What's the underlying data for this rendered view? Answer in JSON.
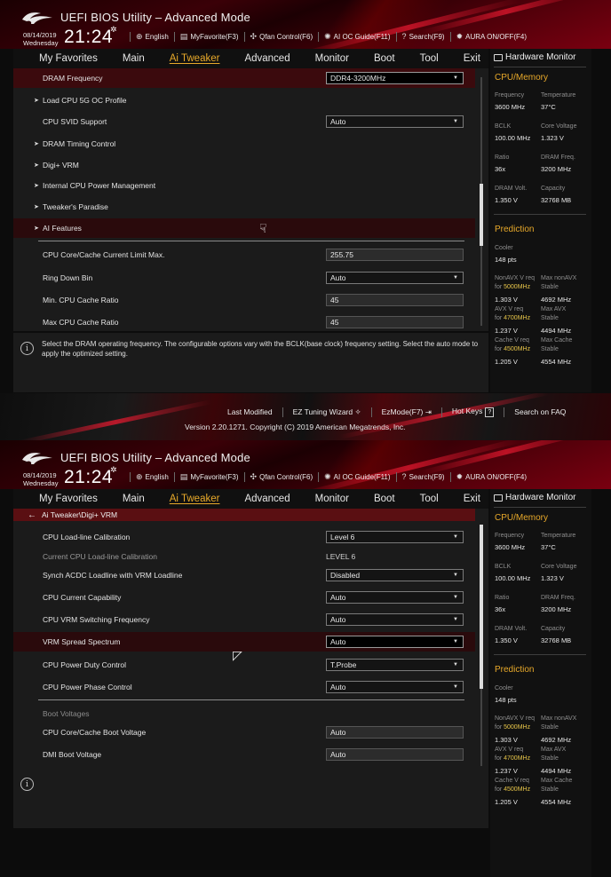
{
  "header": {
    "title": "UEFI BIOS Utility – Advanced Mode",
    "date": "08/14/2019",
    "weekday": "Wednesday",
    "time": "21:24",
    "toolbar": [
      {
        "icon": "globe-icon",
        "glyph": "⊕",
        "label": "English"
      },
      {
        "icon": "favorite-icon",
        "glyph": "▤",
        "label": "MyFavorite(F3)"
      },
      {
        "icon": "fan-icon",
        "glyph": "✣",
        "label": "Qfan Control(F6)"
      },
      {
        "icon": "ai-oc-icon",
        "glyph": "✺",
        "label": "AI OC Guide(F11)"
      },
      {
        "icon": "search-icon",
        "glyph": "?",
        "label": "Search(F9)"
      },
      {
        "icon": "aura-icon",
        "glyph": "✹",
        "label": "AURA ON/OFF(F4)"
      }
    ]
  },
  "nav": {
    "tabs": [
      "My Favorites",
      "Main",
      "Ai Tweaker",
      "Advanced",
      "Monitor",
      "Boot",
      "Tool",
      "Exit"
    ],
    "active": "Ai Tweaker"
  },
  "screen1": {
    "rows": [
      {
        "label": "DRAM Frequency",
        "value": "DDR4-3200MHz"
      },
      {
        "label": "Load CPU 5G OC Profile"
      },
      {
        "label": "CPU SVID Support",
        "value": "Auto"
      },
      {
        "label": "DRAM Timing Control"
      },
      {
        "label": "Digi+ VRM"
      },
      {
        "label": "Internal CPU Power Management"
      },
      {
        "label": "Tweaker's Paradise"
      },
      {
        "label": "AI Features"
      },
      {
        "label": "CPU Core/Cache Current Limit Max.",
        "value": "255.75"
      },
      {
        "label": "Ring Down Bin",
        "value": "Auto"
      },
      {
        "label": "Min. CPU Cache Ratio",
        "value": "45"
      },
      {
        "label": "Max CPU Cache Ratio",
        "value": "45"
      }
    ],
    "help": "Select the DRAM operating frequency. The configurable options vary with the BCLK(base clock) frequency setting. Select the auto mode to apply the optimized setting."
  },
  "screen2": {
    "breadcrumb": "Ai Tweaker\\Digi+ VRM",
    "rows": [
      {
        "label": "CPU Load-line Calibration",
        "value": "Level 6"
      },
      {
        "label": "Current CPU Load-line Calibration",
        "value": "LEVEL 6"
      },
      {
        "label": "Synch ACDC Loadline with VRM Loadline",
        "value": "Disabled"
      },
      {
        "label": "CPU Current Capability",
        "value": "Auto"
      },
      {
        "label": "CPU VRM Switching Frequency",
        "value": "Auto"
      },
      {
        "label": "VRM Spread Spectrum",
        "value": "Auto"
      },
      {
        "label": "CPU Power Duty Control",
        "value": "T.Probe"
      },
      {
        "label": "CPU Power Phase Control",
        "value": "Auto"
      },
      {
        "label": "Boot Voltages"
      },
      {
        "label": "CPU Core/Cache Boot Voltage",
        "value": "Auto"
      },
      {
        "label": "DMI Boot Voltage",
        "value": "Auto"
      }
    ]
  },
  "hw": {
    "title": "Hardware Monitor",
    "cpu_section": "CPU/Memory",
    "frequency_label": "Frequency",
    "frequency": "3600 MHz",
    "temperature_label": "Temperature",
    "temperature": "37°C",
    "bclk_label": "BCLK",
    "bclk": "100.00 MHz",
    "core_voltage_label": "Core Voltage",
    "core_voltage": "1.323 V",
    "ratio_label": "Ratio",
    "ratio": "36x",
    "dram_freq_label": "DRAM Freq.",
    "dram_freq": "3200 MHz",
    "dram_volt_label": "DRAM Volt.",
    "dram_volt": "1.350 V",
    "capacity_label": "Capacity",
    "capacity": "32768 MB",
    "prediction_section": "Prediction",
    "cooler_label": "Cooler",
    "cooler": "148 pts",
    "nonavx_req": "NonAVX V req",
    "for": "for",
    "nonavx_freq": "5000MHz",
    "nonavx_v": "1.303 V",
    "max_nonavx": "Max nonAVX",
    "stable": "Stable",
    "max_nonavx_v": "4692 MHz",
    "avx_req": "AVX V req",
    "avx_freq": "4700MHz",
    "avx_v": "1.237 V",
    "max_avx": "Max AVX",
    "max_avx_v": "4494 MHz",
    "cache_req": "Cache V req",
    "cache_freq": "4500MHz",
    "cache_v": "1.205 V",
    "max_cache": "Max Cache",
    "max_cache_v": "4554 MHz"
  },
  "band": {
    "last_modified": "Last Modified",
    "ez_tuning": "EZ Tuning Wizard",
    "ez_mode": "EzMode(F7)",
    "hot_keys": "Hot Keys",
    "hot_keys_key": "?",
    "search_faq": "Search on FAQ",
    "version": "Version 2.20.1271. Copyright (C) 2019 American Megatrends, Inc."
  }
}
